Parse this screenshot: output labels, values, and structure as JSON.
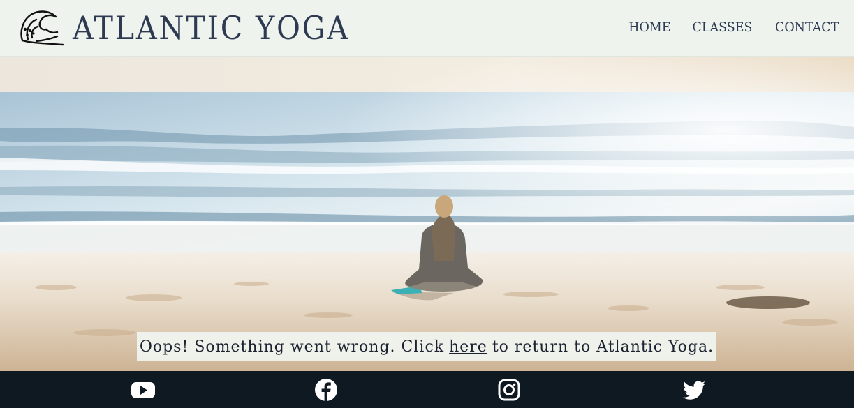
{
  "brand": {
    "name": "ATLANTIC YOGA",
    "logo_icon": "wave-icon"
  },
  "nav": {
    "items": [
      {
        "label": "HOME"
      },
      {
        "label": "CLASSES"
      },
      {
        "label": "CONTACT"
      }
    ]
  },
  "hero": {
    "image": "woman-meditating-on-beach"
  },
  "error": {
    "before": "Oops! Something went wrong. Click",
    "link": "here",
    "after": "to return to Atlantic Yoga."
  },
  "footer": {
    "social": [
      {
        "icon": "youtube-icon"
      },
      {
        "icon": "facebook-icon"
      },
      {
        "icon": "instagram-icon"
      },
      {
        "icon": "twitter-icon"
      }
    ]
  },
  "colors": {
    "header_bg": "#eef3ee",
    "brand_text": "#2d3a52",
    "footer_bg": "#0e1922"
  }
}
